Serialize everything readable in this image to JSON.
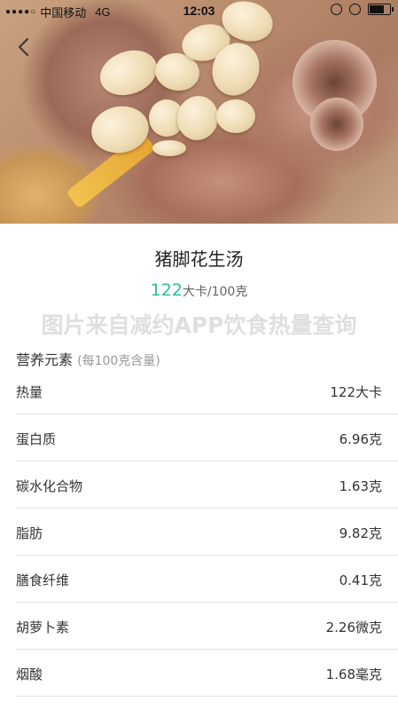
{
  "status_bar": {
    "signal": "●●●●○",
    "carrier": "中国移动",
    "network": "4G",
    "time": "12:03",
    "battery_level": 0.65
  },
  "food": {
    "name": "猪脚花生汤",
    "calorie_value": "122",
    "calorie_unit": "大卡/100克"
  },
  "watermark": "图片来自减约APP饮食热量查询",
  "nutrition": {
    "title": "营养元素",
    "subtitle": "(每100克含量)",
    "items": [
      {
        "name": "热量",
        "value": "122大卡"
      },
      {
        "name": "蛋白质",
        "value": "6.96克"
      },
      {
        "name": "碳水化合物",
        "value": "1.63克"
      },
      {
        "name": "脂肪",
        "value": "9.82克"
      },
      {
        "name": "膳食纤维",
        "value": "0.41克"
      },
      {
        "name": "胡萝卜素",
        "value": "2.26微克"
      },
      {
        "name": "烟酸",
        "value": "1.68毫克"
      }
    ]
  }
}
